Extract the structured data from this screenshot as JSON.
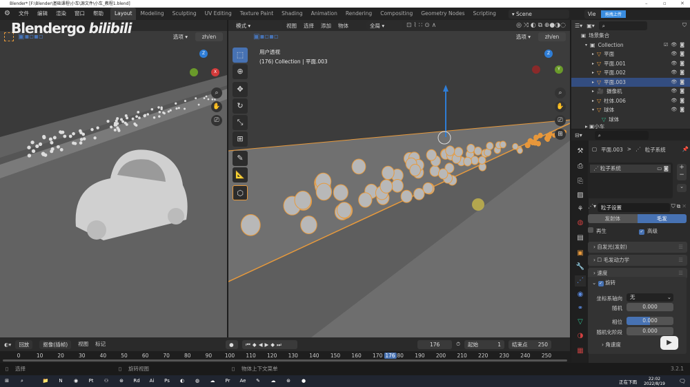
{
  "window": {
    "title": "Blender* [F:\\Blender\\基础课程\\小车\\源文件\\小车_教程1.blend]",
    "min": "–",
    "max": "▫",
    "close": "✕"
  },
  "menu": {
    "items": [
      "文件",
      "编辑",
      "渲染",
      "窗口",
      "帮助"
    ],
    "workspaces": [
      "Layout",
      "Modeling",
      "Sculpting",
      "UV Editing",
      "Texture Paint",
      "Shading",
      "Animation",
      "Rendering",
      "Compositing",
      "Geometry Nodes",
      "Scripting"
    ],
    "active_workspace": "Layout",
    "scene": "Scene",
    "view_layer": "Vie",
    "upload_badge": "拖拽上传"
  },
  "watermark": {
    "text": "Blendergo",
    "logo": "bilibili"
  },
  "left_viewport": {
    "options": "选项",
    "lang": "zh/en"
  },
  "main_viewport": {
    "mode": "模式",
    "menus": [
      "视图",
      "选择",
      "添加",
      "物体"
    ],
    "transform": "全局",
    "options": "选项",
    "lang": "zh/en",
    "view_name": "用户透视",
    "info": "(176) Collection | 平面.003"
  },
  "outliner": {
    "root": "场景集合",
    "items": [
      {
        "name": "Collection",
        "type": "collection"
      },
      {
        "name": "平面",
        "type": "mesh"
      },
      {
        "name": "平面.001",
        "type": "mesh"
      },
      {
        "name": "平面.002",
        "type": "mesh"
      },
      {
        "name": "平面.003",
        "type": "mesh",
        "selected": true
      },
      {
        "name": "摄像机",
        "type": "camera"
      },
      {
        "name": "柱体.006",
        "type": "mesh"
      },
      {
        "name": "球体",
        "type": "mesh"
      },
      {
        "name": "球体",
        "type": "mesh-data"
      }
    ],
    "partial": "小车"
  },
  "properties": {
    "breadcrumb_object": "平面.003",
    "breadcrumb_sep": ">",
    "breadcrumb_system": "粒子系统",
    "particle_system": "粒子系统",
    "settings": "粒子设置",
    "tabs": [
      "发射体",
      "毛发"
    ],
    "active_tab": "毛发",
    "regrow": {
      "label": "再生",
      "checked": false
    },
    "advanced": {
      "label": "高级",
      "checked": true
    },
    "sections": [
      "自发光(发射)",
      "毛发动力学",
      "速度"
    ],
    "rotation": {
      "label": "旋转",
      "checked": true,
      "axis_label": "坐标系轴向",
      "axis_value": "无",
      "random_label": "随机",
      "random": "0.000",
      "phase_label": "相位",
      "phase": "0.000",
      "phase_fraction": 0.5,
      "random_phase_label": "随机化阶段",
      "random_phase": "0.000",
      "angular": "角速度"
    },
    "physics": "物理"
  },
  "timeline": {
    "menus": [
      "回放",
      "抠像(插帧)",
      "视图",
      "标记"
    ],
    "current_frame": "176",
    "start_label": "起始",
    "start": "1",
    "end_label": "结束点",
    "end": "250",
    "ticks": [
      "0",
      "10",
      "20",
      "30",
      "40",
      "50",
      "60",
      "70",
      "80",
      "90",
      "100",
      "110",
      "120",
      "130",
      "140",
      "150",
      "160",
      "170",
      "180",
      "190",
      "200",
      "210",
      "220",
      "230",
      "240",
      "250"
    ]
  },
  "status": {
    "select": "选择",
    "rotate": "旋转视图",
    "context": "物体上下文菜单",
    "version": "3.2.1"
  },
  "taskbar": {
    "weather": "正在下雨",
    "time": "22:02",
    "date": "2022/8/19",
    "apps": [
      "📁",
      "N",
      "◉",
      "Pt",
      "⚇",
      "⊛",
      "Rd",
      "Ai",
      "Ps",
      "◐",
      "◍",
      "☁",
      "Pr",
      "Ae",
      "✎",
      "☁",
      "⊛",
      "●"
    ]
  },
  "colors": {
    "accent": "#4772b3",
    "selection": "#e89a3c",
    "bg": "#393939"
  }
}
